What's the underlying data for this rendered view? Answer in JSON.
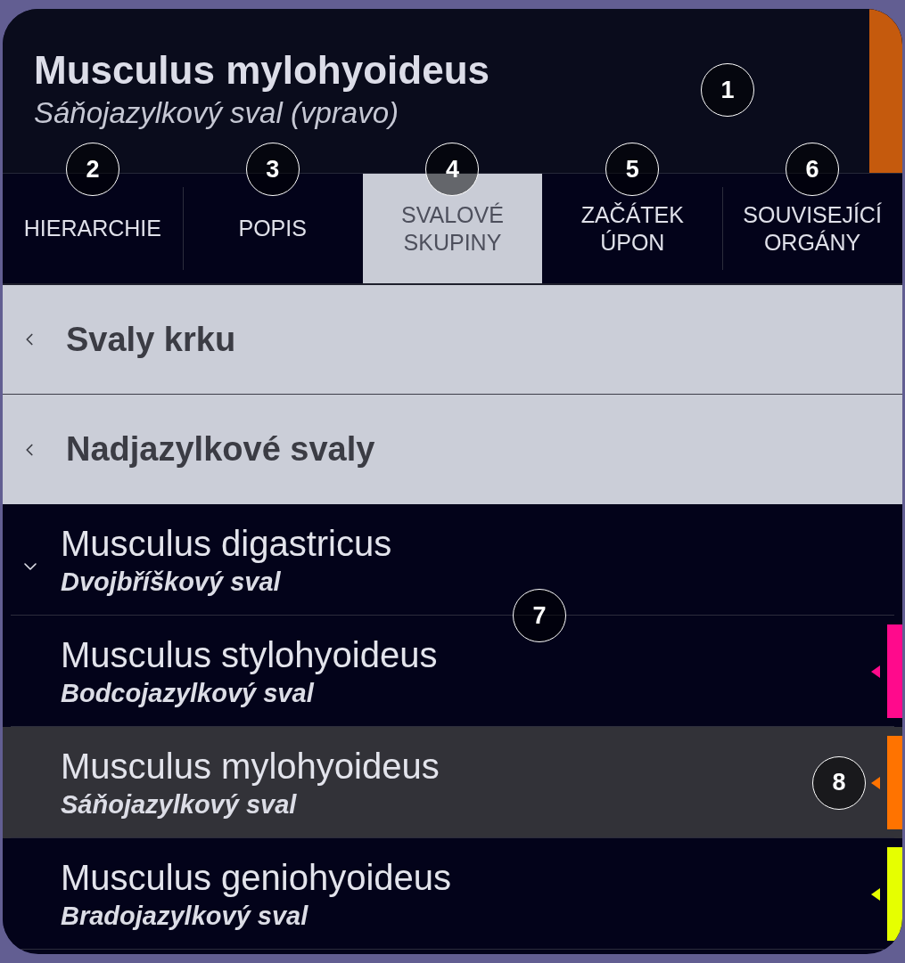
{
  "header": {
    "title": "Musculus mylohyoideus",
    "subtitle": "Sáňojazylkový sval (vpravo)",
    "callout": "1"
  },
  "tabs": [
    {
      "label": "HIERARCHIE",
      "selected": false,
      "callout": "2"
    },
    {
      "label": "POPIS",
      "selected": false,
      "callout": "3"
    },
    {
      "label": "SVALOVÉ SKUPINY",
      "selected": true,
      "callout": "4"
    },
    {
      "label": "ZAČÁTEK ÚPON",
      "selected": false,
      "callout": "5"
    },
    {
      "label": "SOUVISEJÍCÍ ORGÁNY",
      "selected": false,
      "callout": "6"
    }
  ],
  "breadcrumbs": [
    {
      "label": "Svaly krku"
    },
    {
      "label": "Nadjazylkové svaly"
    }
  ],
  "muscle_tree": {
    "callout": "7",
    "items": [
      {
        "name": "Musculus digastricus",
        "czech_name": "Dvojbříškový sval",
        "selected": false,
        "expanded": true,
        "children": [
          {
            "name": "Musculus stylohyoideus",
            "czech_name": "Bodcojazylkový sval",
            "selected": false,
            "color": "#ff0a8c"
          },
          {
            "name": "Musculus mylohyoideus",
            "czech_name": "Sáňojazylkový sval",
            "selected": true,
            "color": "#ff7300",
            "callout": "8"
          },
          {
            "name": "Musculus geniohyoideus",
            "czech_name": "Bradojazylkový sval",
            "selected": false,
            "color": "#e6ff00"
          }
        ]
      }
    ]
  }
}
